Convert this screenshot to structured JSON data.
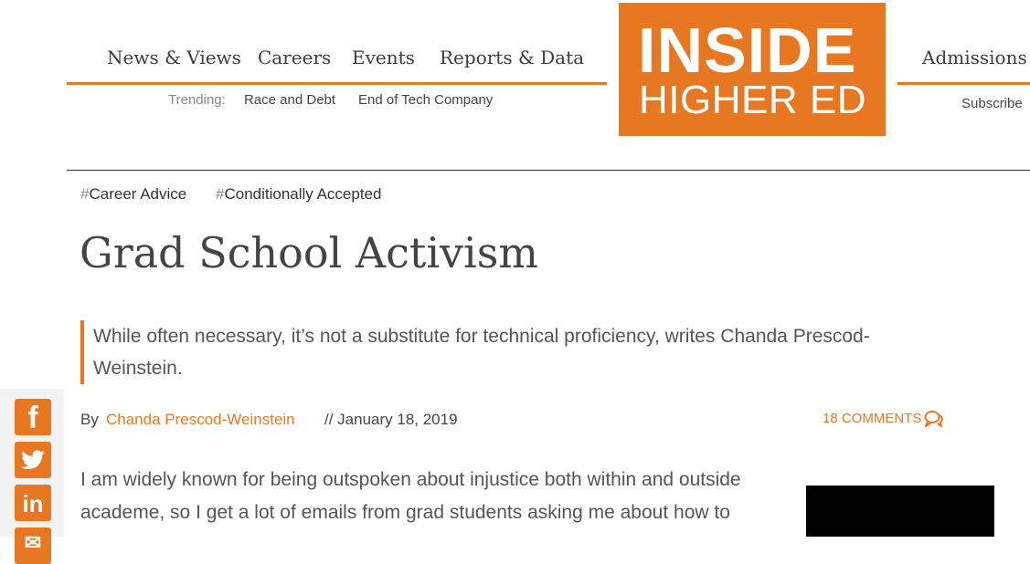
{
  "header": {
    "nav": [
      "News & Views",
      "Careers",
      "Events",
      "Reports & Data"
    ],
    "trending_label": "Trending:",
    "trending": [
      "Race and Debt",
      "End of Tech Company"
    ],
    "logo_line1": "INSIDE",
    "logo_line2": "HIGHER ED",
    "right_nav": "Admissions",
    "subscribe": "Subscribe"
  },
  "article": {
    "tags": [
      "Career Advice",
      "Conditionally Accepted"
    ],
    "title": "Grad School Activism",
    "deck": "While often necessary, it’s not a substitute for technical proficiency, writes Chanda Prescod-Weinstein.",
    "by_label": "By",
    "author": "Chanda Prescod-Weinstein",
    "date": "// January 18, 2019",
    "comments": "18 COMMENTS",
    "body": "I am widely known for being outspoken about injustice both within and outside academe, so I get a lot of emails from grad students asking me about how to"
  },
  "social": [
    "facebook-icon",
    "twitter-icon",
    "linkedin-icon"
  ],
  "colors": {
    "accent": "#e87722"
  }
}
